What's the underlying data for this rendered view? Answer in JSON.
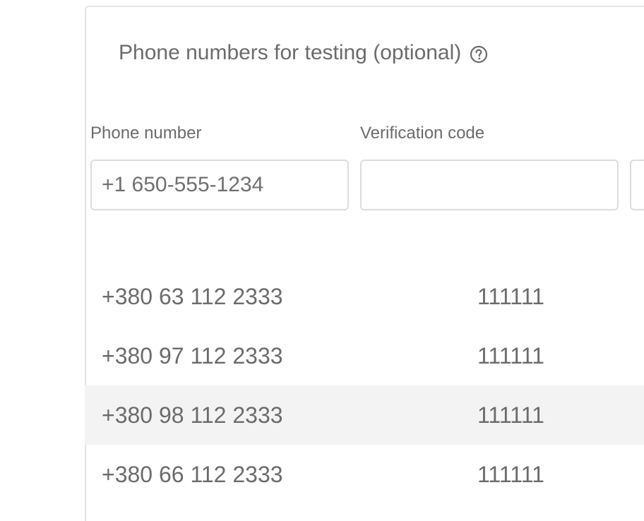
{
  "section": {
    "title": "Phone numbers for testing (optional)",
    "help_icon": "help-circle-icon"
  },
  "form": {
    "phone_label": "Phone number",
    "phone_placeholder": "+1 650-555-1234",
    "phone_value": "",
    "code_label": "Verification code",
    "code_placeholder": "",
    "code_value": ""
  },
  "test_numbers": [
    {
      "phone": "+380 63 112 2333",
      "code": "111111"
    },
    {
      "phone": "+380 97 112 2333",
      "code": "111111"
    },
    {
      "phone": "+380 98 112 2333",
      "code": "111111"
    },
    {
      "phone": "+380 66 112 2333",
      "code": "111111"
    }
  ],
  "colors": {
    "text": "#6b6b6b",
    "border": "#dadce0",
    "row_hover": "#f3f3f3"
  }
}
